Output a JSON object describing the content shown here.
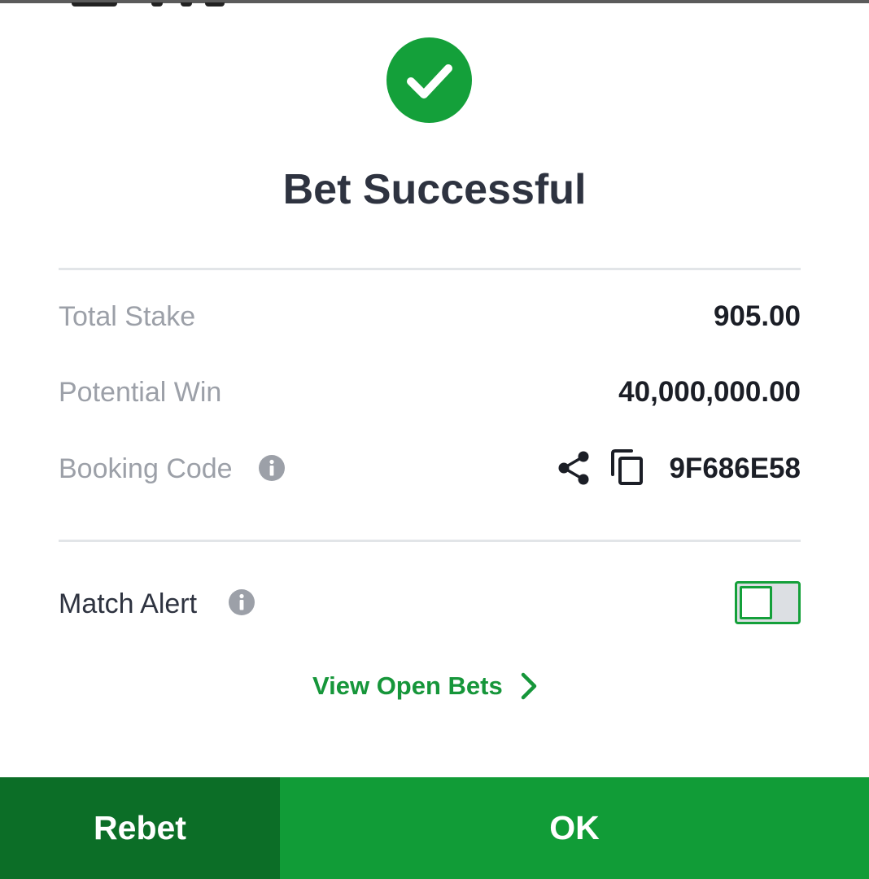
{
  "title": "Bet Successful",
  "rows": {
    "total_stake": {
      "label": "Total Stake",
      "value": "905.00"
    },
    "potential_win": {
      "label": "Potential Win",
      "value": "40,000,000.00"
    },
    "booking_code": {
      "label": "Booking Code",
      "value": "9F686E58"
    }
  },
  "match_alert": {
    "label": "Match Alert",
    "enabled": false
  },
  "view_open_bets": "View Open Bets",
  "buttons": {
    "rebet": "Rebet",
    "ok": "OK"
  },
  "icons": {
    "success": "check-circle-icon",
    "info": "info-icon",
    "share": "share-icon",
    "copy": "copy-icon",
    "chevron": "chevron-right-icon"
  },
  "colors": {
    "accent": "#119c37",
    "accent_dark": "#0c6e27",
    "title_text": "#2e3340",
    "muted_text": "#9ca0a8",
    "value_text": "#1b1e26"
  }
}
